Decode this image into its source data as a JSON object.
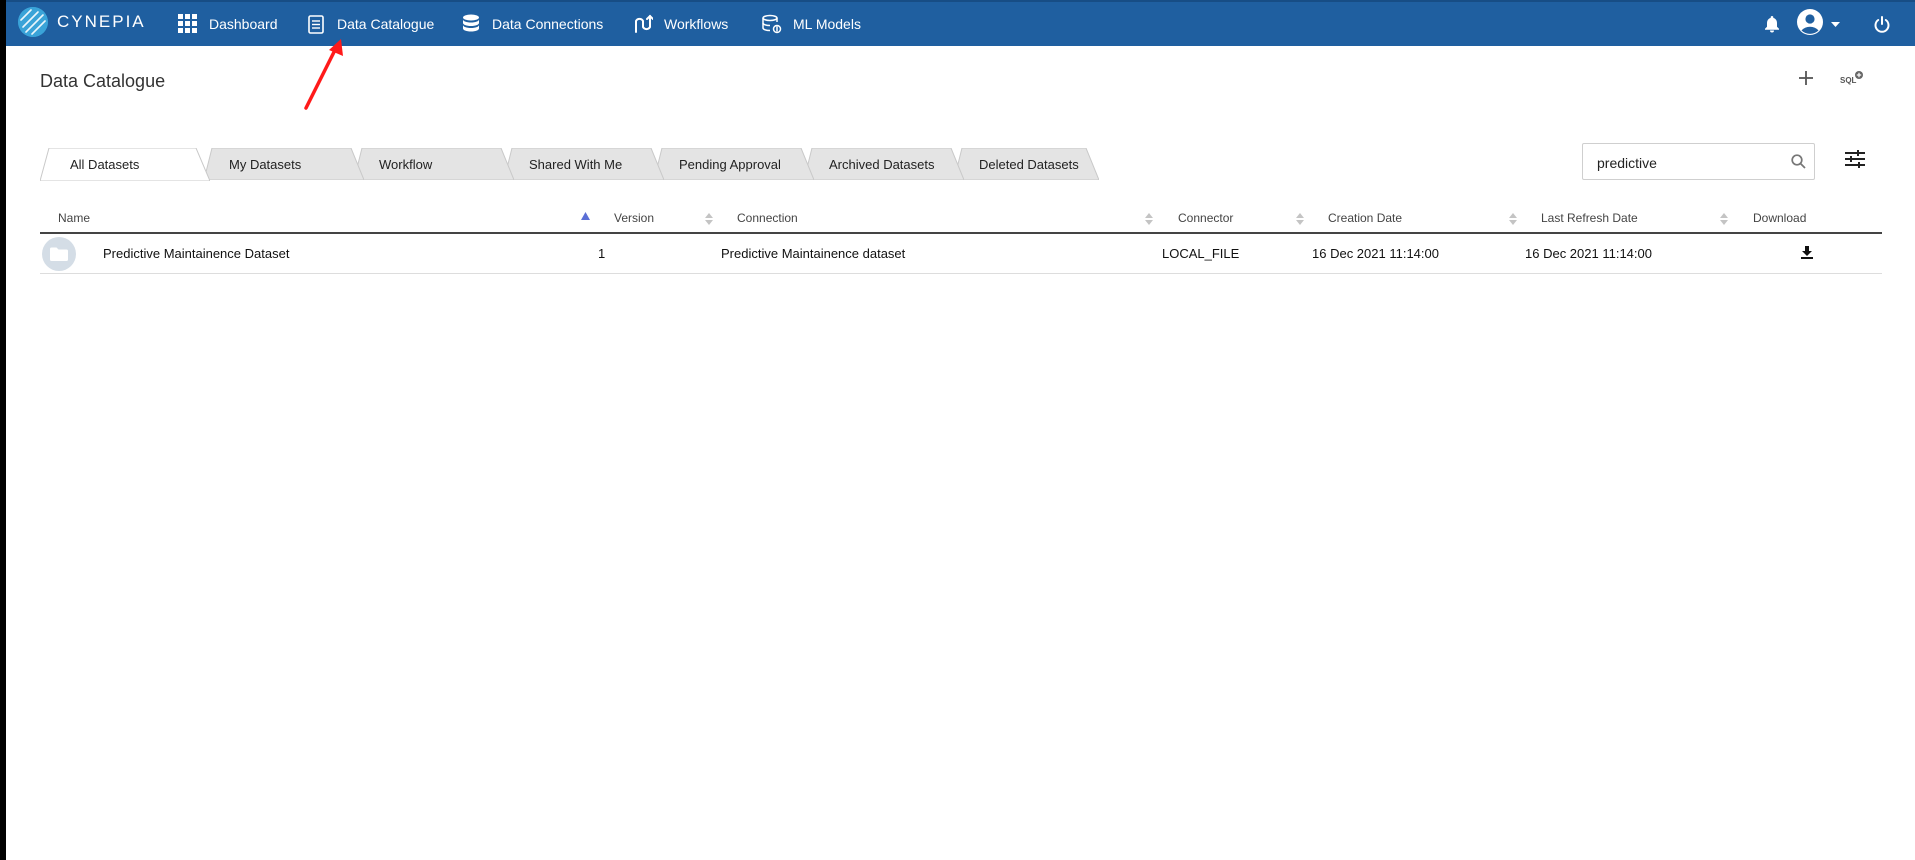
{
  "brand": {
    "name": "CYNEPIA"
  },
  "nav": {
    "items": [
      {
        "label": "Dashboard",
        "icon": "grid-icon"
      },
      {
        "label": "Data Catalogue",
        "icon": "document-icon"
      },
      {
        "label": "Data Connections",
        "icon": "database-icon"
      },
      {
        "label": "Workflows",
        "icon": "workflow-icon"
      },
      {
        "label": "ML Models",
        "icon": "ml-model-icon"
      }
    ],
    "right_icons": [
      "bell-icon",
      "user-avatar-icon",
      "caret-down-icon",
      "power-icon"
    ]
  },
  "page": {
    "title": "Data Catalogue",
    "actions": [
      "plus-icon",
      "sql-add-icon"
    ]
  },
  "tabs": [
    {
      "label": "All Datasets",
      "active": true
    },
    {
      "label": "My Datasets",
      "active": false
    },
    {
      "label": "Workflow",
      "active": false
    },
    {
      "label": "Shared With Me",
      "active": false
    },
    {
      "label": "Pending Approval",
      "active": false
    },
    {
      "label": "Archived Datasets",
      "active": false
    },
    {
      "label": "Deleted Datasets",
      "active": false
    }
  ],
  "search": {
    "value": "predictive",
    "icon": "search-icon"
  },
  "filter": {
    "icon": "sliders-icon"
  },
  "table": {
    "columns": [
      "Name",
      "Version",
      "Connection",
      "Connector",
      "Creation Date",
      "Last Refresh Date",
      "Download"
    ],
    "sorted_column": "Name",
    "sort_direction": "ascending",
    "rows": [
      {
        "name": "Predictive Maintainence Dataset",
        "version": "1",
        "connection": "Predictive Maintainence dataset",
        "connector": "LOCAL_FILE",
        "creation_date": "16 Dec 2021 11:14:00",
        "last_refresh_date": "16 Dec 2021 11:14:00",
        "download_icon": "download-icon"
      }
    ]
  },
  "colors": {
    "nav_bg": "#1f5fa0",
    "tab_active_bg": "#ffffff",
    "tab_inactive_bg": "#e4e4e4",
    "annotation_arrow": "#ff1a1a",
    "sort_active": "#5b6fd6"
  }
}
